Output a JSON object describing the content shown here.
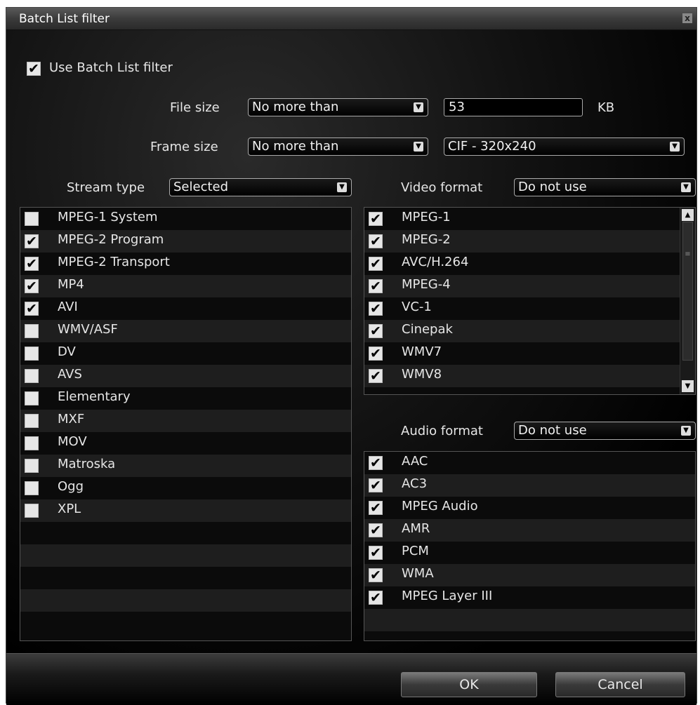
{
  "window": {
    "title": "Batch List filter",
    "close_label": "x"
  },
  "use_filter": {
    "label": "Use Batch List filter",
    "checked": true
  },
  "file_size": {
    "label": "File size",
    "mode": "No more than",
    "value": "53",
    "unit": "KB"
  },
  "frame_size": {
    "label": "Frame size",
    "mode": "No more than",
    "value": "CIF - 320x240"
  },
  "stream_type": {
    "label": "Stream type",
    "value": "Selected"
  },
  "video_format": {
    "label": "Video format",
    "value": "Do not use"
  },
  "audio_format": {
    "label": "Audio format",
    "value": "Do not use"
  },
  "stream_items": [
    {
      "label": "MPEG-1 System",
      "checked": false
    },
    {
      "label": "MPEG-2 Program",
      "checked": true
    },
    {
      "label": "MPEG-2 Transport",
      "checked": true
    },
    {
      "label": "MP4",
      "checked": true
    },
    {
      "label": "AVI",
      "checked": true
    },
    {
      "label": "WMV/ASF",
      "checked": false
    },
    {
      "label": "DV",
      "checked": false
    },
    {
      "label": "AVS",
      "checked": false
    },
    {
      "label": "Elementary",
      "checked": false
    },
    {
      "label": "MXF",
      "checked": false
    },
    {
      "label": "MOV",
      "checked": false
    },
    {
      "label": "Matroska",
      "checked": false
    },
    {
      "label": "Ogg",
      "checked": false
    },
    {
      "label": "XPL",
      "checked": false
    }
  ],
  "video_items": [
    {
      "label": "MPEG-1",
      "checked": true
    },
    {
      "label": "MPEG-2",
      "checked": true
    },
    {
      "label": "AVC/H.264",
      "checked": true
    },
    {
      "label": "MPEG-4",
      "checked": true
    },
    {
      "label": "VC-1",
      "checked": true
    },
    {
      "label": "Cinepak",
      "checked": true
    },
    {
      "label": "WMV7",
      "checked": true
    },
    {
      "label": "WMV8",
      "checked": true
    }
  ],
  "audio_items": [
    {
      "label": "AAC",
      "checked": true
    },
    {
      "label": "AC3",
      "checked": true
    },
    {
      "label": "MPEG Audio",
      "checked": true
    },
    {
      "label": "AMR",
      "checked": true
    },
    {
      "label": "PCM",
      "checked": true
    },
    {
      "label": "WMA",
      "checked": true
    },
    {
      "label": "MPEG Layer III",
      "checked": true
    }
  ],
  "buttons": {
    "ok": "OK",
    "cancel": "Cancel"
  },
  "icons": {
    "check": "✔",
    "dropdown": "▼",
    "scroll_up": "▲",
    "scroll_down": "▼",
    "grip": "≡"
  }
}
